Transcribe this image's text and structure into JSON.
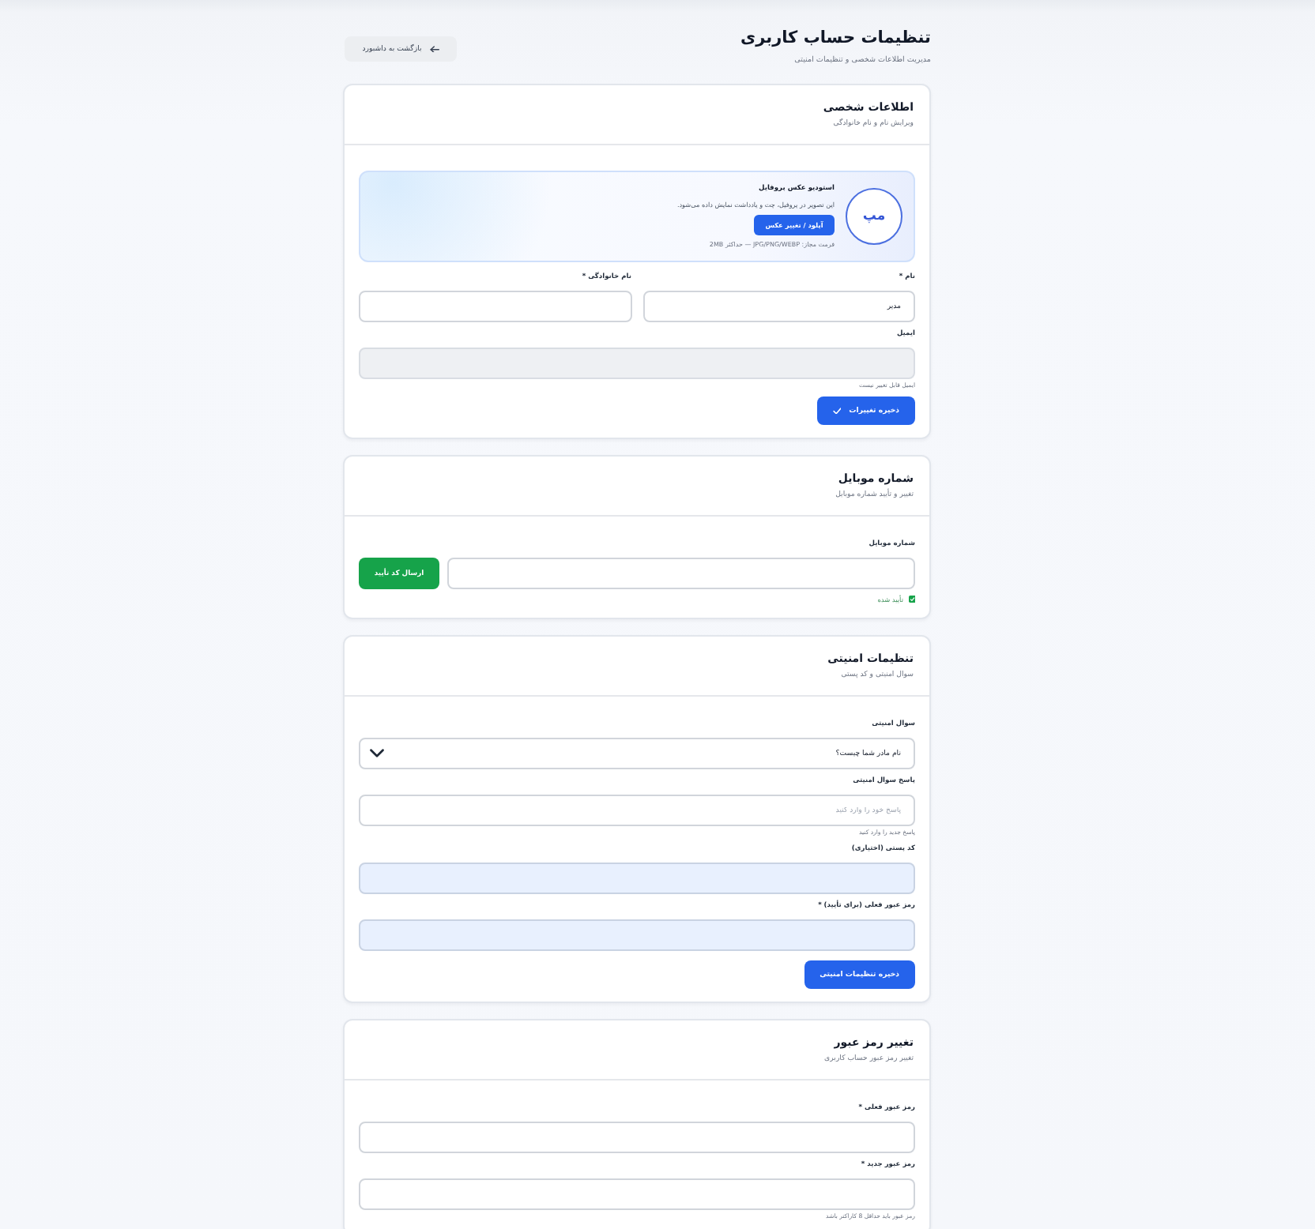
{
  "header": {
    "title": "تنظیمات حساب کاربری",
    "subtitle": "مدیریت اطلاعات شخصی و تنظیمات امنیتی",
    "back_button": "بازگشت به داشبورد"
  },
  "sections": [
    {
      "kind": "profile",
      "title": "اطلاعات شخصی",
      "subtitle": "ویرایش نام و نام خانوادگی",
      "photo": {
        "initials": "مپ",
        "title": "استودیو عکس پروفایل",
        "description": "این تصویر در پروفیل، چت و یادداشت نمایش داده می‌شود.",
        "button": "آپلود / تغییر عکس",
        "hint": "فرمت مجاز: JPG/PNG/WEBP — حداکثر 2MB"
      },
      "name_fields": [
        {
          "label": "نام *",
          "value": "مدیر",
          "disabled": false,
          "autofilled": false
        },
        {
          "label": "نام خانوادگی *",
          "disabled": false,
          "autofilled": false
        }
      ],
      "fields": [
        {
          "kind": "text",
          "label": "ایمیل",
          "hint": "ایمیل قابل تغییر نیست",
          "disabled": true,
          "autofilled": false
        }
      ],
      "save_button": "ذخیره تغییرات"
    },
    {
      "kind": "phone",
      "title": "شماره موبایل",
      "subtitle": "تغییر و تأیید شماره موبایل",
      "fields": [
        {
          "kind": "phone",
          "label": "شماره موبایل",
          "button": "ارسال کد تأیید",
          "status": "تأیید شده",
          "verified": true,
          "disabled": false,
          "autofilled": false
        }
      ]
    },
    {
      "kind": "security",
      "title": "تنظیمات امنیتی",
      "subtitle": "سوال امنیتی و کد پستی",
      "fields": [
        {
          "kind": "select",
          "label": "سوال امنیتی",
          "value": "نام مادر شما چیست؟",
          "disabled": false,
          "autofilled": false
        },
        {
          "kind": "text",
          "label": "پاسخ سوال امنیتی",
          "placeholder": "پاسخ خود را وارد کنید",
          "hint": "پاسخ جدید را وارد کنید",
          "disabled": false,
          "autofilled": false
        },
        {
          "kind": "text",
          "label": "کد پستی (اختیاری)",
          "disabled": false,
          "autofilled": true
        },
        {
          "kind": "text",
          "label": "رمز عبور فعلی (برای تأیید) *",
          "disabled": false,
          "autofilled": true
        }
      ],
      "save_button": "ذخیره تنظیمات امنیتی"
    },
    {
      "kind": "password",
      "title": "تغییر رمز عبور",
      "subtitle": "تغییر رمز عبور حساب کاربری",
      "fields": [
        {
          "kind": "text",
          "label": "رمز عبور فعلی *",
          "disabled": false,
          "autofilled": false
        },
        {
          "kind": "text",
          "label": "رمز عبور جدید *",
          "hint": "رمز عبور باید حداقل 8 کاراکتر باشد",
          "disabled": false,
          "autofilled": false
        }
      ]
    }
  ]
}
